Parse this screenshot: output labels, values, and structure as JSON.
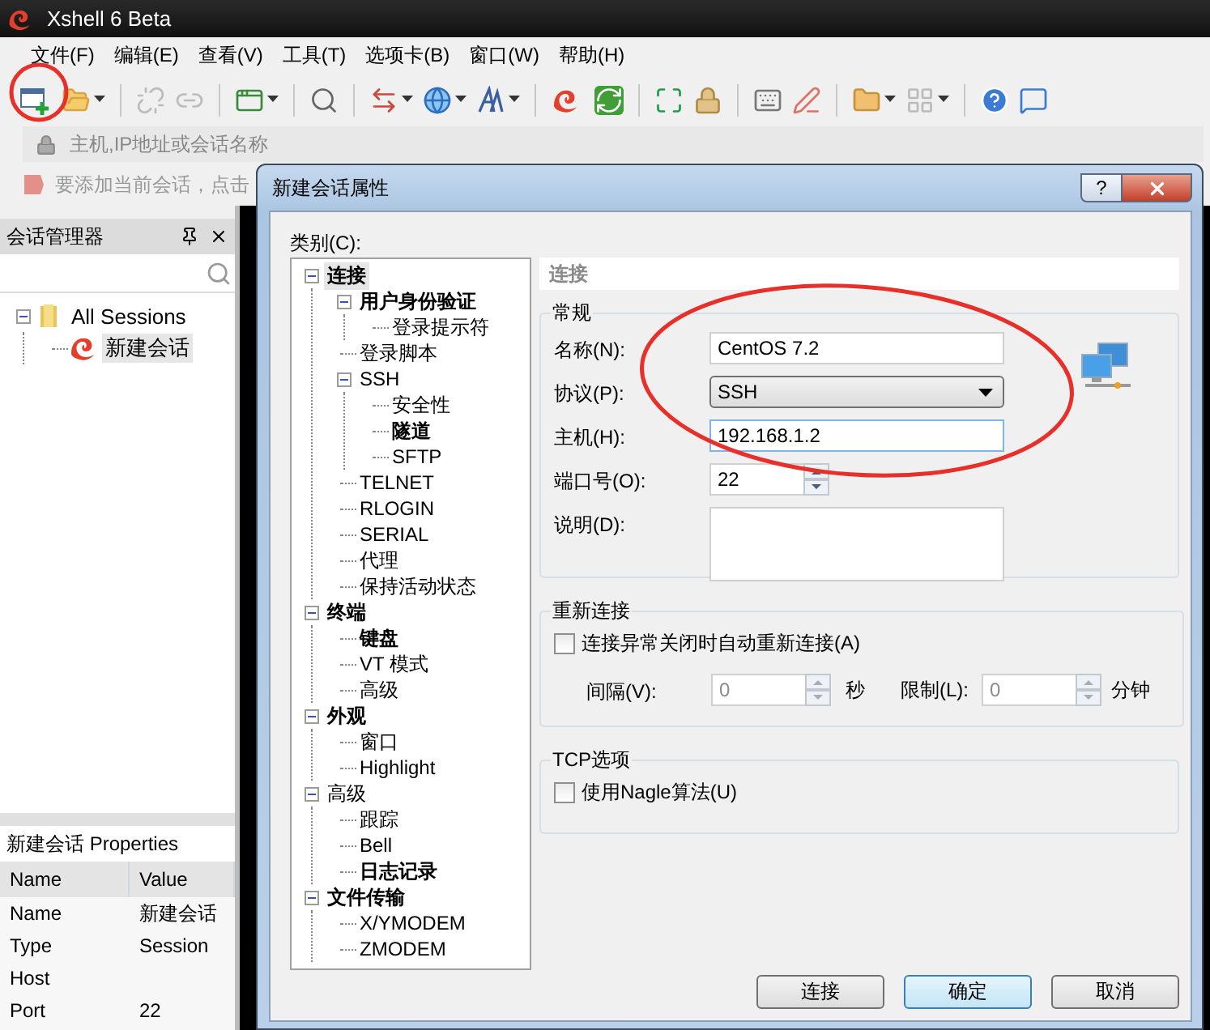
{
  "window": {
    "title": "Xshell 6 Beta"
  },
  "menu": [
    "文件(F)",
    "编辑(E)",
    "查看(V)",
    "工具(T)",
    "选项卡(B)",
    "窗口(W)",
    "帮助(H)"
  ],
  "address_bar": {
    "placeholder": "主机,IP地址或会话名称"
  },
  "hint_bar": {
    "text": "要添加当前会话，点击"
  },
  "session_manager": {
    "title": "会话管理器",
    "tree": [
      {
        "label": "All Sessions",
        "kind": "folder",
        "selected": false,
        "expanded": true,
        "children": [
          {
            "label": "新建会话",
            "kind": "session",
            "selected": true
          }
        ]
      }
    ]
  },
  "properties": {
    "title": "新建会话 Properties",
    "columns": [
      "Name",
      "Value"
    ],
    "rows": [
      {
        "name": "Name",
        "value": "新建会话"
      },
      {
        "name": "Type",
        "value": "Session"
      },
      {
        "name": "Host"
      },
      {
        "name": "Port",
        "value": "22"
      }
    ]
  },
  "dialog": {
    "title": "新建会话属性",
    "help": "?",
    "category_label": "类别(C):",
    "categories": [
      {
        "label": "连接",
        "bold": true,
        "selected": true,
        "expanded": true,
        "children": [
          {
            "label": "用户身份验证",
            "bold": true,
            "selected": false,
            "expanded": true,
            "children": [
              {
                "label": "登录提示符",
                "bold": false,
                "selected": false
              }
            ]
          },
          {
            "label": "登录脚本",
            "bold": false,
            "selected": false
          },
          {
            "label": "SSH",
            "bold": false,
            "selected": false,
            "expanded": true,
            "children": [
              {
                "label": "安全性",
                "bold": false,
                "selected": false
              },
              {
                "label": "隧道",
                "bold": true,
                "selected": false
              },
              {
                "label": "SFTP",
                "bold": false,
                "selected": false
              }
            ]
          },
          {
            "label": "TELNET",
            "bold": false,
            "selected": false
          },
          {
            "label": "RLOGIN",
            "bold": false,
            "selected": false
          },
          {
            "label": "SERIAL",
            "bold": false,
            "selected": false
          },
          {
            "label": "代理",
            "bold": false,
            "selected": false
          },
          {
            "label": "保持活动状态",
            "bold": false,
            "selected": false
          }
        ]
      },
      {
        "label": "终端",
        "bold": true,
        "selected": false,
        "expanded": true,
        "children": [
          {
            "label": "键盘",
            "bold": true,
            "selected": false
          },
          {
            "label": "VT 模式",
            "bold": false,
            "selected": false
          },
          {
            "label": "高级",
            "bold": false,
            "selected": false
          }
        ]
      },
      {
        "label": "外观",
        "bold": true,
        "selected": false,
        "expanded": true,
        "children": [
          {
            "label": "窗口",
            "bold": false,
            "selected": false
          },
          {
            "label": "Highlight",
            "bold": false,
            "selected": false
          }
        ]
      },
      {
        "label": "高级",
        "bold": false,
        "selected": false,
        "expanded": true,
        "children": [
          {
            "label": "跟踪",
            "bold": false,
            "selected": false
          },
          {
            "label": "Bell",
            "bold": false,
            "selected": false
          },
          {
            "label": "日志记录",
            "bold": true,
            "selected": false
          }
        ]
      },
      {
        "label": "文件传输",
        "bold": true,
        "selected": false,
        "expanded": true,
        "children": [
          {
            "label": "X/YMODEM",
            "bold": false,
            "selected": false
          },
          {
            "label": "ZMODEM",
            "bold": false,
            "selected": false
          }
        ]
      }
    ],
    "section_title": "连接",
    "general": {
      "legend": "常规",
      "fields": [
        {
          "kind": "text",
          "label": "名称(N):",
          "value": "CentOS 7.2",
          "focused": false
        },
        {
          "kind": "select",
          "label": "协议(P):",
          "value": "SSH"
        },
        {
          "kind": "text",
          "label": "主机(H):",
          "value": "192.168.1.2",
          "focused": true
        },
        {
          "kind": "spinner",
          "label": "端口号(O):",
          "value": "22"
        },
        {
          "kind": "textarea",
          "label": "说明(D):"
        }
      ]
    },
    "reconnect": {
      "legend": "重新连接",
      "checkbox": {
        "label": "连接异常关闭时自动重新连接(A)",
        "checked": false
      },
      "interval": {
        "label": "间隔(V):",
        "value": "0",
        "unit": "秒",
        "disabled": true
      },
      "limit": {
        "label": "限制(L):",
        "value": "0",
        "unit": "分钟",
        "disabled": true
      }
    },
    "tcp": {
      "legend": "TCP选项",
      "checkbox": {
        "label": "使用Nagle算法(U)",
        "checked": false
      }
    },
    "buttons": [
      {
        "label": "连接",
        "default": false
      },
      {
        "label": "确定",
        "default": true
      },
      {
        "label": "取消",
        "default": false
      }
    ]
  }
}
